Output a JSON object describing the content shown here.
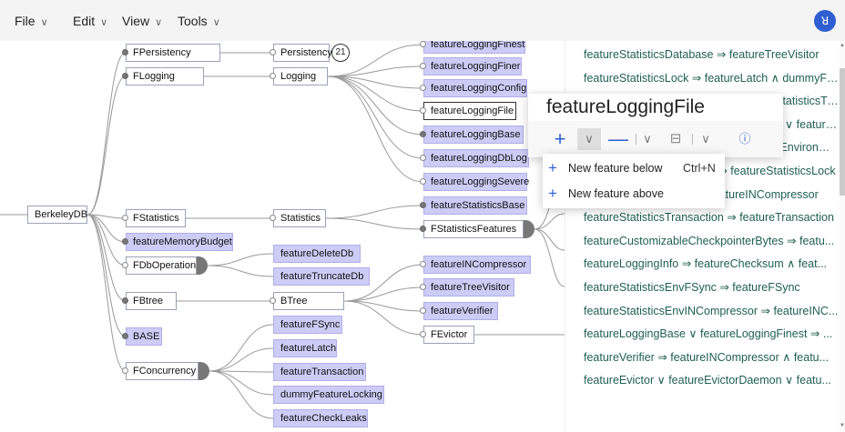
{
  "menubar": {
    "items": [
      {
        "label": "File",
        "icon": "chevron-down-icon"
      },
      {
        "label": "Edit",
        "icon": "chevron-down-icon"
      },
      {
        "label": "View",
        "icon": "chevron-down-icon"
      },
      {
        "label": "Tools",
        "icon": "chevron-down-icon"
      }
    ],
    "avatar_initial": "ꓤ",
    "avatar_color": "#2f5fd0"
  },
  "colors": {
    "concrete_feature": "#cdccf6",
    "abstract_feature": "#ffffff",
    "mandatory_marker": "#777777",
    "accent": "#2f5fd0",
    "constraint_text": "#1f5f4f"
  },
  "tree": {
    "root": "BerkeleyDB",
    "nodes": [
      {
        "id": "BerkeleyDB",
        "label": "BerkeleyDB",
        "concrete": false
      },
      {
        "id": "FPersistency",
        "label": "FPersistency",
        "concrete": false
      },
      {
        "id": "FLogging",
        "label": "FLogging",
        "concrete": false
      },
      {
        "id": "FStatistics",
        "label": "FStatistics",
        "concrete": false
      },
      {
        "id": "featureMemoryBudget",
        "label": "featureMemoryBudget",
        "concrete": true
      },
      {
        "id": "FDbOperation",
        "label": "FDbOperation",
        "concrete": false
      },
      {
        "id": "FBtree",
        "label": "FBtree",
        "concrete": false
      },
      {
        "id": "BASE",
        "label": "BASE",
        "concrete": true
      },
      {
        "id": "FConcurrency",
        "label": "FConcurrency",
        "concrete": false
      },
      {
        "id": "Persistency",
        "label": "Persistency",
        "concrete": false,
        "count": "21"
      },
      {
        "id": "Logging",
        "label": "Logging",
        "concrete": false
      },
      {
        "id": "Statistics",
        "label": "Statistics",
        "concrete": false
      },
      {
        "id": "featureDeleteDb",
        "label": "featureDeleteDb",
        "concrete": true
      },
      {
        "id": "featureTruncateDb",
        "label": "featureTruncateDb",
        "concrete": true
      },
      {
        "id": "BTree",
        "label": "BTree",
        "concrete": false
      },
      {
        "id": "featureFSync",
        "label": "featureFSync",
        "concrete": true
      },
      {
        "id": "featureLatch",
        "label": "featureLatch",
        "concrete": true
      },
      {
        "id": "featureTransaction",
        "label": "featureTransaction",
        "concrete": true
      },
      {
        "id": "dummyFeatureLocking",
        "label": "dummyFeatureLocking",
        "concrete": true
      },
      {
        "id": "featureCheckLeaks",
        "label": "featureCheckLeaks",
        "concrete": true
      },
      {
        "id": "featureLoggingFinest",
        "label": "featureLoggingFinest",
        "concrete": true
      },
      {
        "id": "featureLoggingFiner",
        "label": "featureLoggingFiner",
        "concrete": true
      },
      {
        "id": "featureLoggingConfig",
        "label": "featureLoggingConfig",
        "concrete": true
      },
      {
        "id": "featureLoggingFile",
        "label": "featureLoggingFile",
        "concrete": false,
        "selected": true
      },
      {
        "id": "featureLoggingBase",
        "label": "featureLoggingBase",
        "concrete": true
      },
      {
        "id": "featureLoggingDbLog",
        "label": "featureLoggingDbLog",
        "concrete": true
      },
      {
        "id": "featureLoggingSevere",
        "label": "featureLoggingSevere",
        "concrete": true
      },
      {
        "id": "featureStatisticsBase",
        "label": "featureStatisticsBase",
        "concrete": true
      },
      {
        "id": "FStatisticsFeatures",
        "label": "FStatisticsFeatures",
        "concrete": false
      },
      {
        "id": "featureINCompressor",
        "label": "featureINCompressor",
        "concrete": true
      },
      {
        "id": "featureTreeVisitor",
        "label": "featureTreeVisitor",
        "concrete": true
      },
      {
        "id": "featureVerifier",
        "label": "featureVerifier",
        "concrete": true
      },
      {
        "id": "FEvictor",
        "label": "FEvictor",
        "concrete": false
      }
    ]
  },
  "constraints": [
    "featureStatisticsDatabase ⇒ featureTreeVisitor",
    "featureStatisticsLock ⇒ featureLatch ∧ dummyFeatureLocking ...",
    "featureStatisticsTransaction ⇒ featureStatisticsTransact...",
    "featureEvictor ∨ featureEvictorDaemon ∨ featureLookAheadCacheFor ∧ feat...",
    "featureStatisticsEnvironment ⇒ featureEnvironmentLo...",
    "featureStatisticsLockStats ⇒ featureStatisticsLock",
    "featureCriticalEviction ⇒ featureINCompressor",
    "featureStatisticsTransaction ⇒ featureTransaction",
    "featureCustomizableCheckpointerBytes ⇒ featu...",
    "featureLoggingInfo ⇒ featureChecksum ∧ feat...",
    "featureStatisticsEnvFSync ⇒ featureFSync",
    "featureStatisticsEnvINCompressor ⇒ featureINC...",
    "featureLoggingBase ∨ featureLoggingFinest ⇒ ...",
    "featureVerifier ⇒ featureINCompressor ∧ featu...",
    "featureEvictor ∨ featureEvictorDaemon ∨ featu..."
  ],
  "popup": {
    "title": "featureLoggingFile",
    "add_icon": "plus-icon",
    "remove_icon": "minus-icon",
    "collapse_icon": "collapse-icon",
    "info_icon": "info-icon"
  },
  "dropdown": {
    "items": [
      {
        "label": "New feature below",
        "shortcut": "Ctrl+N",
        "icon": "plus-icon"
      },
      {
        "label": "New feature above",
        "shortcut": "",
        "icon": "plus-icon"
      }
    ]
  }
}
